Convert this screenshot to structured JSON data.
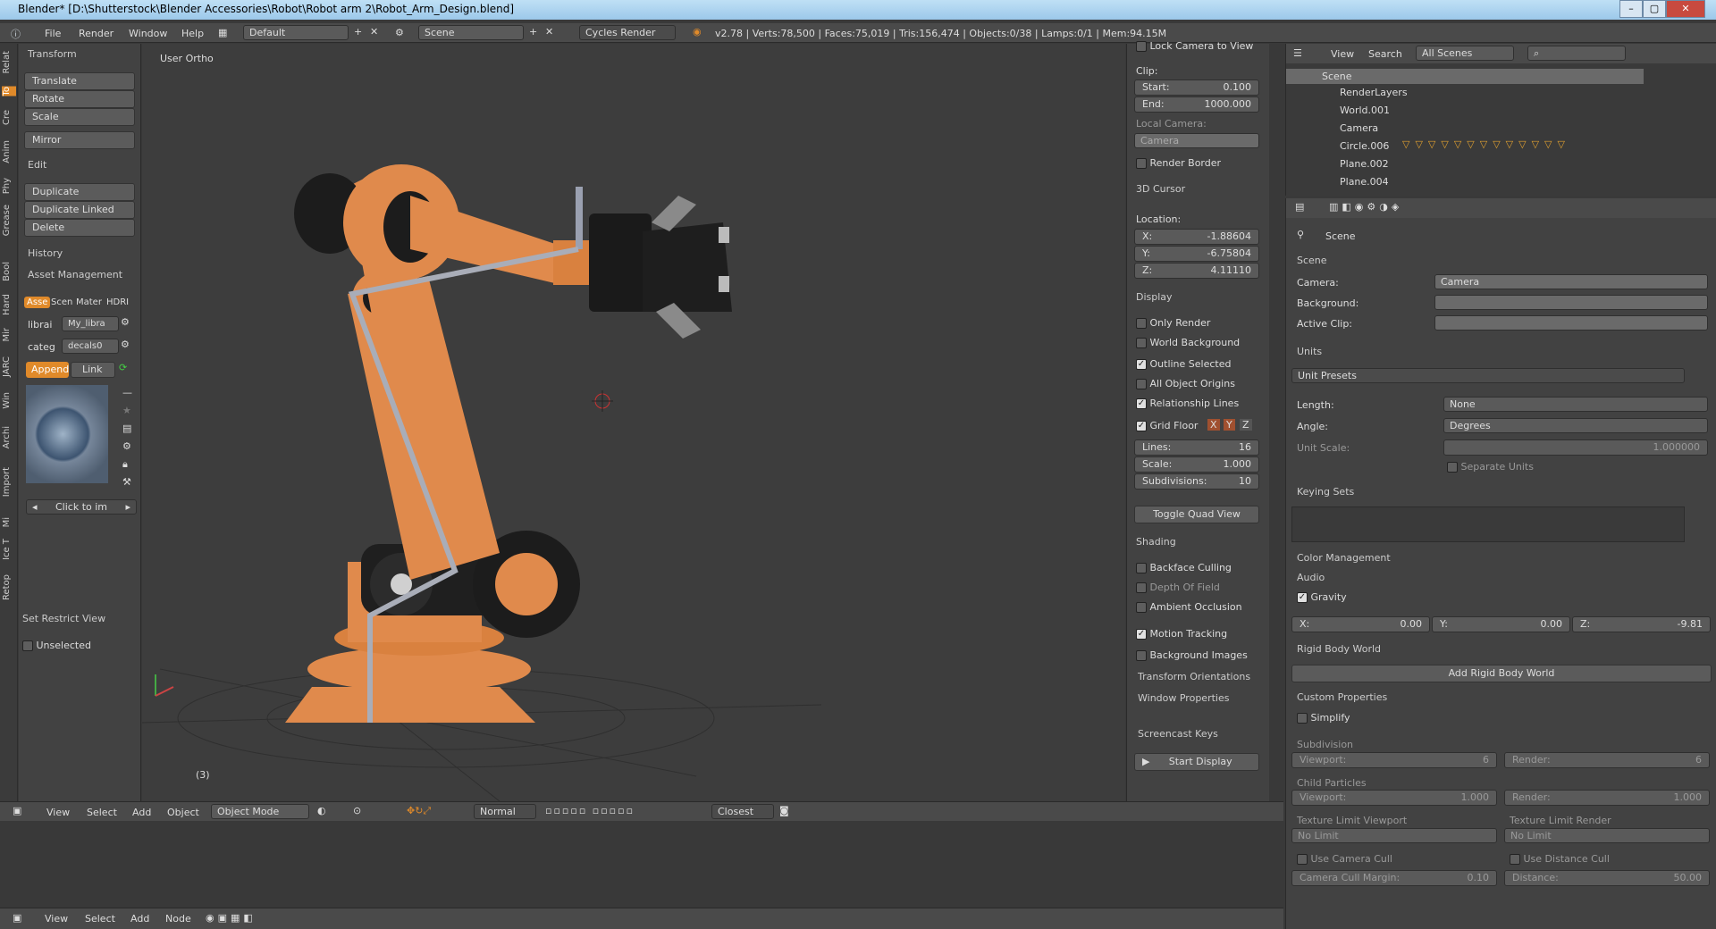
{
  "window": {
    "title": "Blender* [D:\\Shutterstock\\Blender Accessories\\Robot\\Robot arm 2\\Robot_Arm_Design.blend]"
  },
  "topbar": {
    "menus": [
      "File",
      "Render",
      "Window",
      "Help"
    ],
    "layout": "Default",
    "scene": "Scene",
    "engine": "Cycles Render",
    "stats": "v2.78 | Verts:78,500 | Faces:75,019 | Tris:156,474 | Objects:0/38 | Lamps:0/1 | Mem:94.15M"
  },
  "left_tabs": [
    "Relat",
    "To",
    "Cre",
    "Anim",
    "Phy",
    "Grease",
    "Bool",
    "Hard",
    "Mir",
    "JARC",
    "Win",
    "Archi",
    "Import",
    "Mi",
    "Ice T",
    "Retop"
  ],
  "left_panel": {
    "transform_header": "Transform",
    "translate": "Translate",
    "rotate": "Rotate",
    "scale": "Scale",
    "mirror": "Mirror",
    "edit_header": "Edit",
    "duplicate": "Duplicate",
    "duplicate_linked": "Duplicate Linked",
    "delete": "Delete",
    "history_header": "History",
    "asset_header": "Asset Management",
    "asset_tabs": [
      "Asse",
      "Scen",
      "Mater",
      "HDRI"
    ],
    "librar_label": "librai",
    "librar_value": "My_libra",
    "categ_label": "categ",
    "categ_value": "decals0",
    "append": "Append",
    "link": "Link",
    "click_to_im": "Click to im",
    "restrict_header": "Set Restrict View",
    "unselected": "Unselected"
  },
  "viewport": {
    "label": "User Ortho",
    "frame": "(3)"
  },
  "npanel": {
    "lock_camera": "Lock Camera to View",
    "clip": "Clip:",
    "start_label": "Start:",
    "start": "0.100",
    "end_label": "End:",
    "end": "1000.000",
    "local_camera": "Local Camera:",
    "camera": "Camera",
    "render_border": "Render Border",
    "cursor_header": "3D Cursor",
    "location": "Location:",
    "x_label": "X:",
    "x": "-1.88604",
    "y_label": "Y:",
    "y": "-6.75804",
    "z_label": "Z:",
    "z": "4.11110",
    "display_header": "Display",
    "only_render": "Only Render",
    "world_bg": "World Background",
    "outline_selected": "Outline Selected",
    "all_origins": "All Object Origins",
    "relationship_lines": "Relationship Lines",
    "grid_floor": "Grid Floor",
    "axes": [
      "X",
      "Y",
      "Z"
    ],
    "lines_label": "Lines:",
    "lines": "16",
    "scale_label": "Scale:",
    "scale": "1.000",
    "subdiv_label": "Subdivisions:",
    "subdiv": "10",
    "toggle_quad": "Toggle Quad View",
    "shading_header": "Shading",
    "backface": "Backface Culling",
    "dof": "Depth Of Field",
    "ao": "Ambient Occlusion",
    "motion_tracking": "Motion Tracking",
    "background_images": "Background Images",
    "transform_orient": "Transform Orientations",
    "window_props": "Window Properties",
    "screencast": "Screencast Keys",
    "start_display": "Start Display"
  },
  "outliner": {
    "view": "View",
    "search": "Search",
    "filter": "All Scenes",
    "items": [
      "Scene",
      "RenderLayers",
      "World.001",
      "Camera",
      "Circle.006",
      "Plane.002",
      "Plane.004"
    ]
  },
  "properties": {
    "breadcrumb": "Scene",
    "scene_header": "Scene",
    "camera_label": "Camera:",
    "camera": "Camera",
    "background_label": "Background:",
    "active_clip_label": "Active Clip:",
    "units_header": "Units",
    "unit_presets": "Unit Presets",
    "length_label": "Length:",
    "length": "None",
    "angle_label": "Angle:",
    "angle": "Degrees",
    "unit_scale_label": "Unit Scale:",
    "unit_scale": "1.000000",
    "separate_units": "Separate Units",
    "keying_header": "Keying Sets",
    "color_mgmt": "Color Management",
    "audio": "Audio",
    "gravity": "Gravity",
    "gx_label": "X:",
    "gx": "0.00",
    "gy_label": "Y:",
    "gy": "0.00",
    "gz_label": "Z:",
    "gz": "-9.81",
    "rigid_header": "Rigid Body World",
    "add_rigid": "Add Rigid Body World",
    "custom_props": "Custom Properties",
    "simplify": "Simplify",
    "subdivision": "Subdivision",
    "viewport_label": "Viewport:",
    "viewport_val": "6",
    "render_label": "Render:",
    "render_val": "6",
    "child_particles": "Child Particles",
    "cp_viewport": "1.000",
    "cp_render": "1.000",
    "tex_limit_vp": "Texture Limit Viewport",
    "tex_limit_render": "Texture Limit Render",
    "no_limit": "No Limit",
    "use_camera_cull": "Use Camera Cull",
    "use_distance_cull": "Use Distance Cull",
    "cam_cull_margin_label": "Camera Cull Margin:",
    "cam_cull_margin": "0.10",
    "distance_label": "Distance:",
    "distance": "50.00"
  },
  "bottombar": {
    "menus": [
      "View",
      "Select",
      "Add",
      "Object"
    ],
    "mode": "Object Mode",
    "pivot": "Normal",
    "snap": "Closest"
  },
  "nodebar": {
    "menus": [
      "View",
      "Select",
      "Add",
      "Node"
    ]
  }
}
